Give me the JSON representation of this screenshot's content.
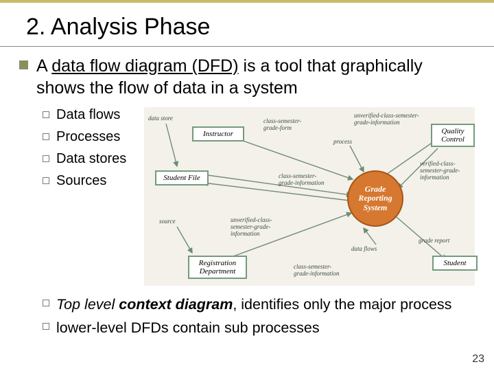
{
  "title": "2. Analysis Phase",
  "main": {
    "prefix": "A ",
    "dfd": "data flow diagram (DFD)",
    "rest": " is a tool that graphically shows the flow of data in a system"
  },
  "sub": {
    "i0": "Data flows",
    "i1": "Processes",
    "i2": "Data stores",
    "i3": "Sources"
  },
  "diagram": {
    "instructor": "Instructor",
    "quality": "Quality\nControl",
    "studentfile": "Student File",
    "grs": "Grade\nReporting\nSystem",
    "regdept": "Registration\nDepartment",
    "student": "Student",
    "labels": {
      "datastore": "data store",
      "classsem": "class-semester-\ngrade-form",
      "unverified": "unverified-class-semester-\ngrade-information",
      "process": "process",
      "verified": "verified-class-\nsemester-grade-\ninformation",
      "classsemgi": "class-semester-\ngrade-information",
      "source": "source",
      "unv2": "unverified-class-\nsemester-grade-\ninformation",
      "dataflows": "data flows",
      "gradereport": "grade report",
      "classsemgi2": "class-semester-\ngrade-information"
    }
  },
  "lower": {
    "l1a": "Top level ",
    "l1b": "context diagram",
    "l1c": ", identifies only the major process",
    "l2": "lower-level DFDs contain sub processes"
  },
  "pagenum": "23"
}
